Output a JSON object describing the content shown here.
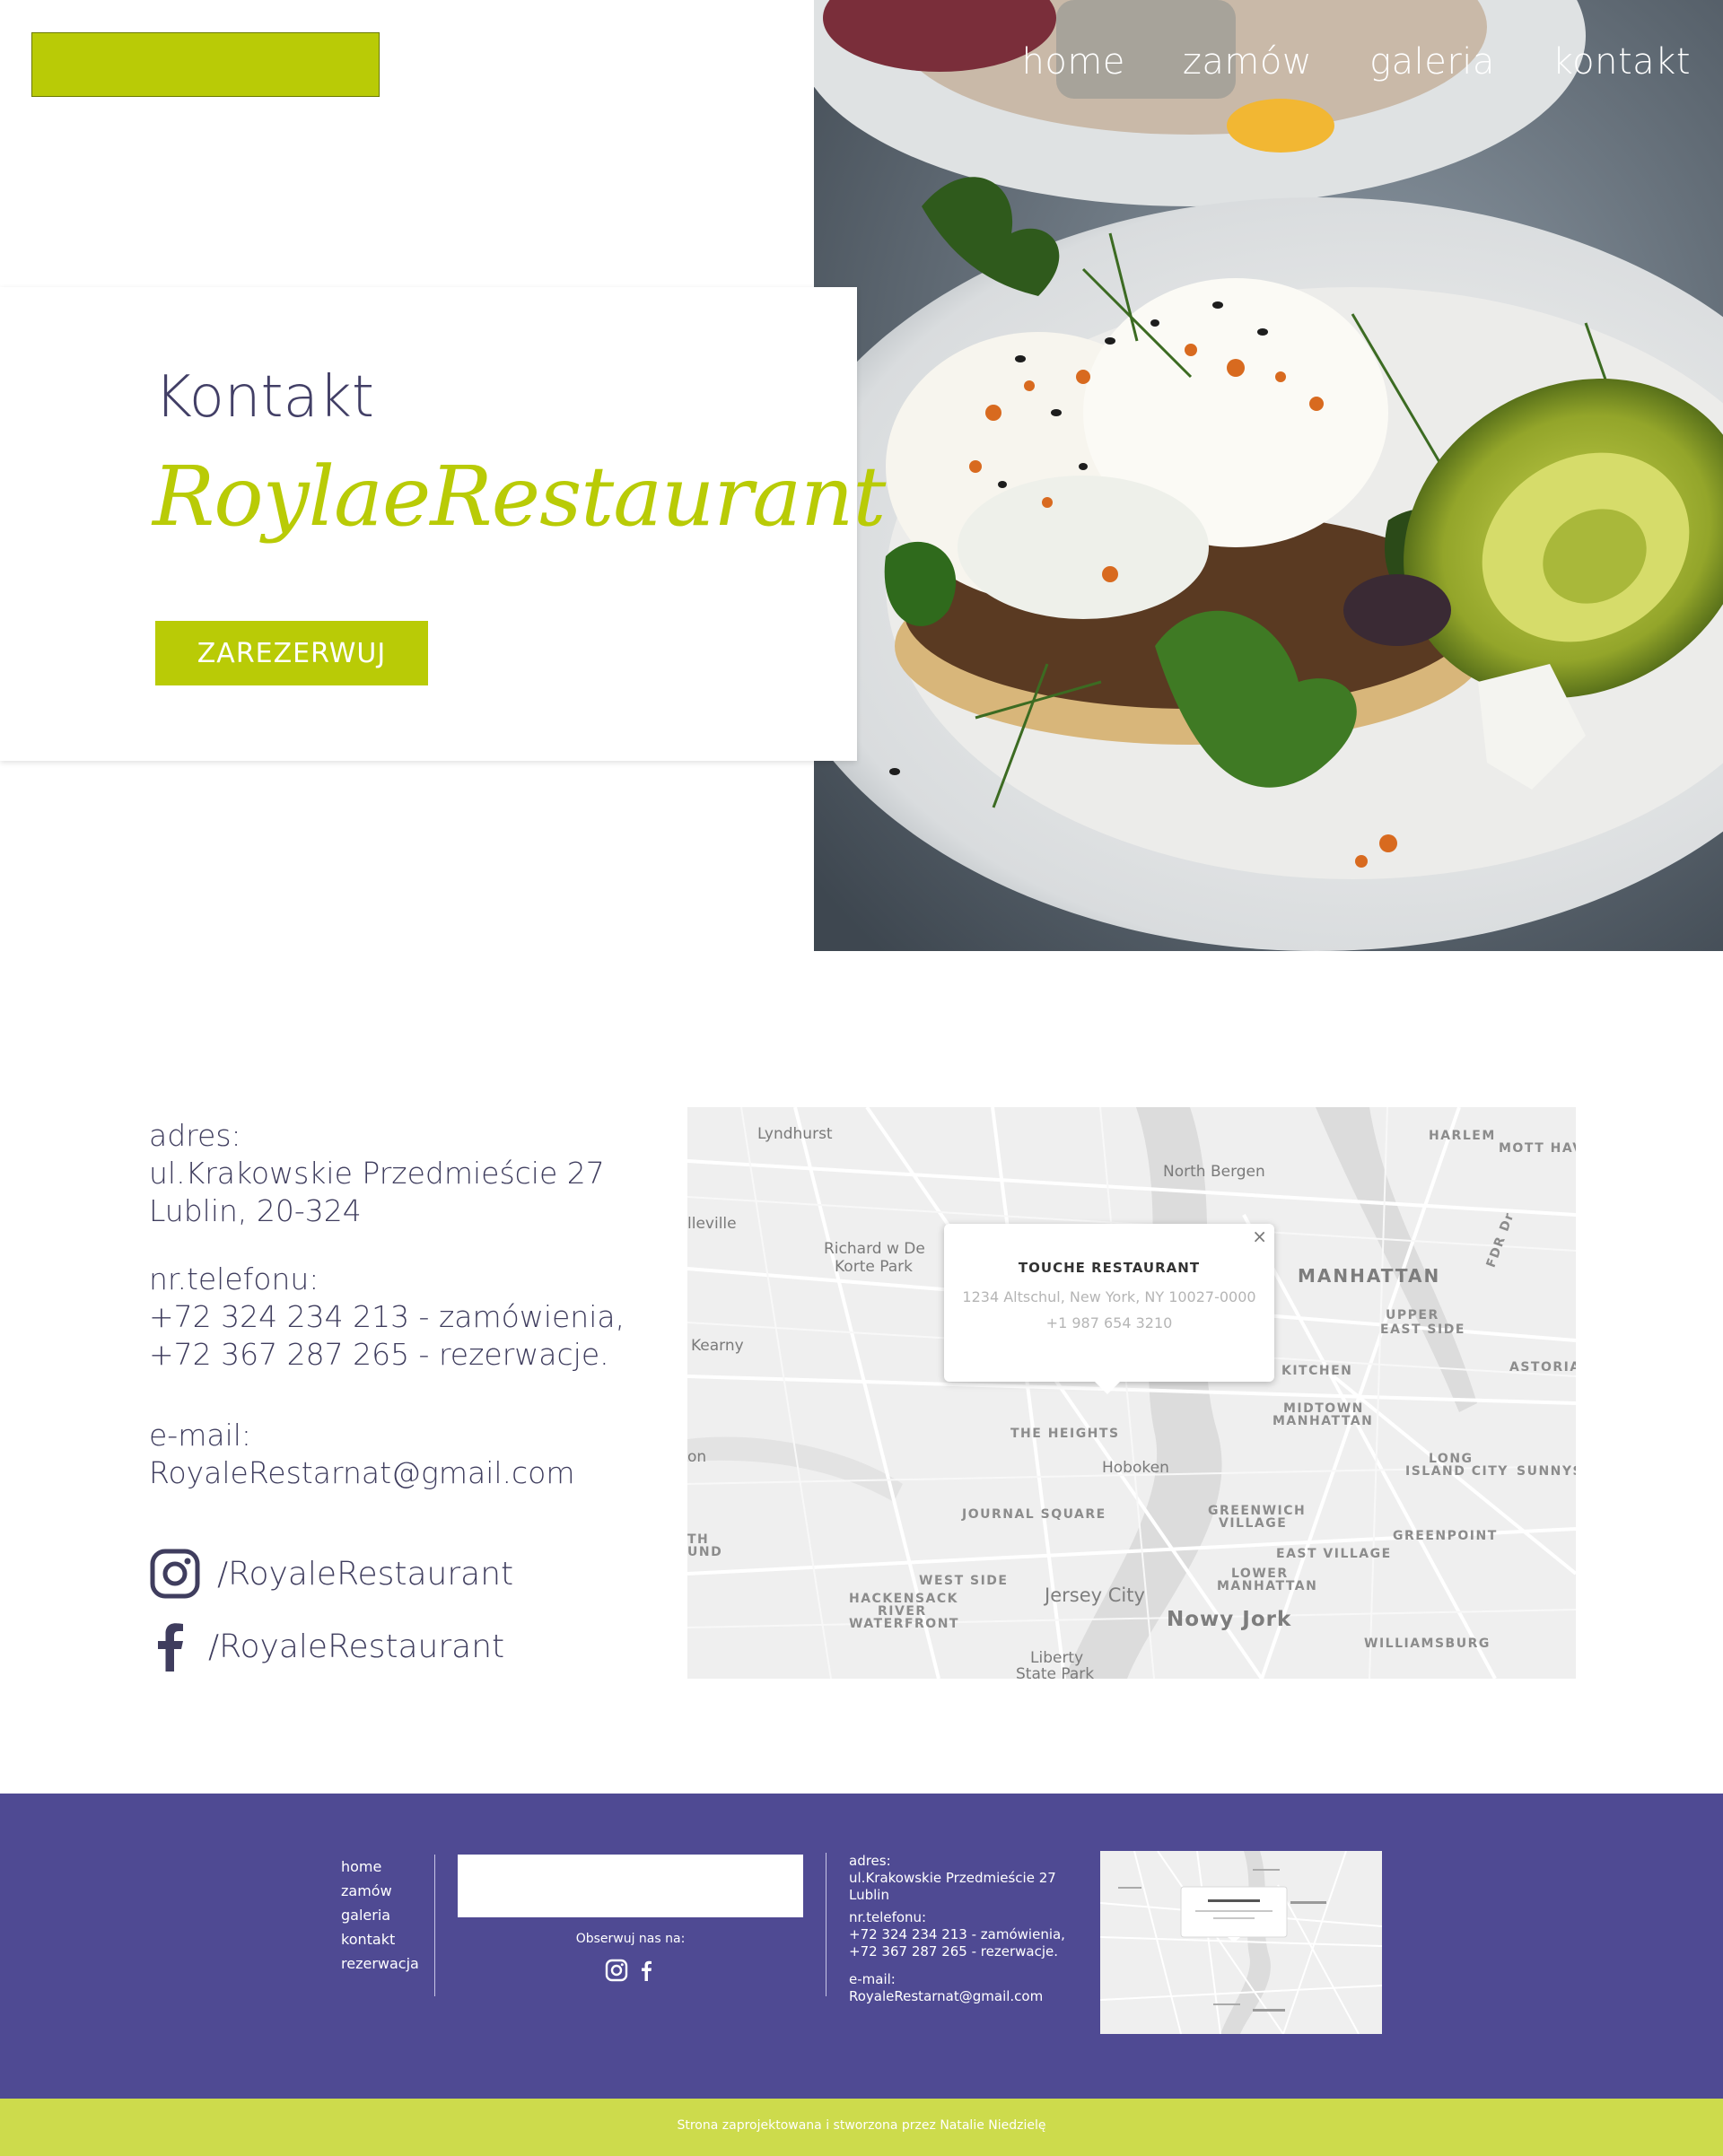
{
  "nav": {
    "items": [
      "home",
      "zamów",
      "galeria",
      "kontakt"
    ]
  },
  "hero": {
    "title": "Kontakt",
    "brand": "RoylaeRestaurant",
    "button": "ZAREZERWUJ"
  },
  "contact": {
    "address_label": "adres:",
    "address_line1": "ul.Krakowskie Przedmieście 27",
    "address_line2": "Lublin, 20-324",
    "phone_label": "nr.telefonu:",
    "phone_line1": "+72 324 234 213 - zamówienia,",
    "phone_line2": "+72 367 287 265 - rezerwacje.",
    "email_label": "e-mail:",
    "email": "RoyaleRestarnat@gmail.com",
    "instagram": "/RoyaleRestaurant",
    "facebook": "/RoyaleRestaurant",
    "instagram_icon": "instagram-icon",
    "facebook_icon": "facebook-icon"
  },
  "map": {
    "popup_title": "TOUCHE RESTAURANT",
    "popup_address": "1234 Altschul, New York, NY 10027-0000",
    "popup_phone": "+1 987 654 3210",
    "close": "×",
    "labels": {
      "lyndhurst": "Lyndhurst",
      "north_bergen": "North Bergen",
      "harlem": "HARLEM",
      "mott_haven": "MOTT HAVE",
      "belleville": "lleville",
      "richard": "Richard w De",
      "korte_park": "Korte Park",
      "manhattan": "MANHATTAN",
      "upper_east_side_1": "UPPER",
      "upper_east_side_2": "EAST SIDE",
      "kearny": "Kearny",
      "kitchen": "KITCHEN",
      "astoria": "ASTORIA",
      "midtown_1": "MIDTOWN",
      "midtown_2": "MANHATTAN",
      "the_heights": "THE HEIGHTS",
      "hoboken": "Hoboken",
      "long_island_1": "LONG",
      "long_island_2": "ISLAND CITY",
      "sunnyside": "SUNNYSI",
      "journal_square": "JOURNAL SQUARE",
      "greenwich_1": "GREENWICH",
      "greenwich_2": "VILLAGE",
      "greenpoint": "GREENPOINT",
      "east_village": "EAST VILLAGE",
      "west_side": "WEST SIDE",
      "lower_1": "LOWER",
      "lower_2": "MANHATTAN",
      "jersey_city": "Jersey City",
      "hackensack_1": "HACKENSACK",
      "hackensack_2": "RIVER",
      "hackensack_3": "WATERFRONT",
      "nowy_jork": "Nowy Jork",
      "williamsburg": "WILLIAMSBURG",
      "liberty_1": "Liberty",
      "liberty_2": "State Park",
      "fdr": "FDR Dr",
      "on": "on",
      "und_1": "TH",
      "und_2": "UND"
    }
  },
  "footer": {
    "nav": [
      "home",
      "zamów",
      "galeria",
      "kontakt",
      "rezerwacja"
    ],
    "follow": "Obserwuj nas na:",
    "address_label": "adres:",
    "address_line1": "ul.Krakowskie Przedmieście 27",
    "address_line2": "Lublin",
    "phone_label": "nr.telefonu:",
    "phone_line1": "+72 324 234 213 - zamówienia,",
    "phone_line2": "+72 367 287 265 - rezerwacje.",
    "email_label": "e-mail:",
    "email": "RoyaleRestarnat@gmail.com",
    "credit": "Strona zaprojektowana i stworzona przez Natalie Niedzielę"
  },
  "colors": {
    "accent": "#b9cb06",
    "footer_bg": "#4f4a93",
    "credit_bar": "#cddb4c",
    "text": "#3f3d5e"
  }
}
